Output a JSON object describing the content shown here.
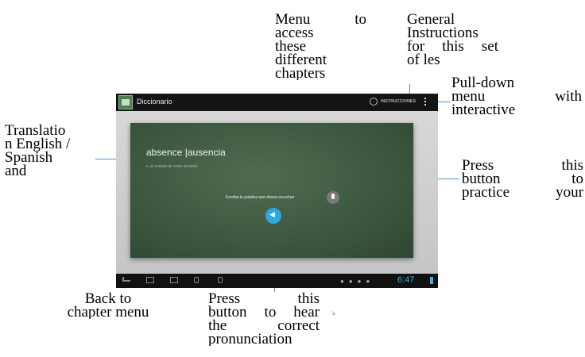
{
  "callouts": {
    "menu": [
      "Menu to",
      "access",
      "these",
      "different",
      "chapters"
    ],
    "instructions": [
      "General",
      "Instructions",
      "for this set",
      "of les"
    ],
    "pulldown": [
      "Pull-down",
      "menu with",
      "interactive"
    ],
    "translation": [
      "Translatio",
      "n English /",
      "Spanish",
      "and"
    ],
    "practice": [
      "Press this",
      "button to",
      "practice your"
    ],
    "back": [
      "Back to",
      "chapter menu"
    ],
    "hear": [
      "Press this",
      "button to hear",
      "the correct",
      "pronunciation"
    ]
  },
  "app": {
    "title": "Diccionario",
    "instructions_button": "INSTRUCCIONES",
    "word": "absence |ausencia",
    "definition": "n. el estado de estar ausente",
    "prompt": "Escriba la palabra que desea escuchar",
    "clock": "6:47"
  },
  "stray_mark": "'a",
  "colors": {
    "accent": "#2ea8e4",
    "board": "#3c573f",
    "leader_line": "#4a90c8"
  },
  "icons": [
    "help-icon",
    "overflow-menu-icon",
    "microphone-icon",
    "speaker-icon",
    "back-icon",
    "home-icon",
    "recent-apps-icon",
    "volume-down-icon",
    "volume-up-icon",
    "wifi-icon",
    "battery-icon"
  ]
}
